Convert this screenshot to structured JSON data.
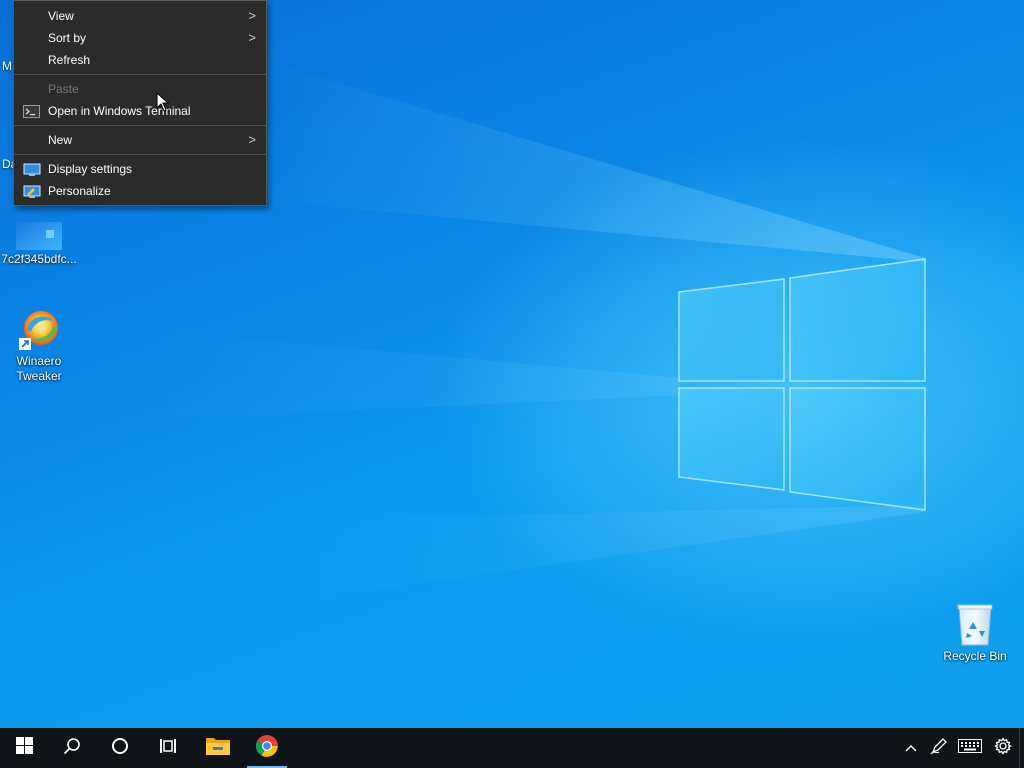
{
  "context_menu": {
    "items": [
      {
        "label": "View",
        "submenu": true
      },
      {
        "label": "Sort by",
        "submenu": true
      },
      {
        "label": "Refresh"
      },
      {
        "label": "Paste",
        "disabled": true
      },
      {
        "label": "Open in Windows Terminal",
        "icon": "terminal-icon"
      },
      {
        "label": "New",
        "submenu": true
      },
      {
        "label": "Display settings",
        "icon": "display-icon"
      },
      {
        "label": "Personalize",
        "icon": "personalize-icon"
      }
    ],
    "submenu_glyph": ">"
  },
  "desktop": {
    "partial_labels": [
      "M",
      "Da"
    ],
    "icons": [
      {
        "label": "7c2f345bdfc...",
        "icon": "image-file-icon"
      },
      {
        "label": "Winaero Tweaker",
        "icon": "winaero-tweaker-icon"
      },
      {
        "label": "Recycle Bin",
        "icon": "recycle-bin-icon"
      }
    ]
  },
  "taskbar": {
    "buttons": [
      "start-icon",
      "search-icon",
      "cortana-icon",
      "task-view-icon",
      "file-explorer-icon",
      "chrome-icon"
    ],
    "tray": [
      "chevron-up-icon",
      "pen-icon",
      "keyboard-icon",
      "settings-gear-icon"
    ]
  },
  "colors": {
    "menu_bg": "#2b2b2b",
    "taskbar_bg": "#101418",
    "desktop_blue": "#0a86e6"
  }
}
